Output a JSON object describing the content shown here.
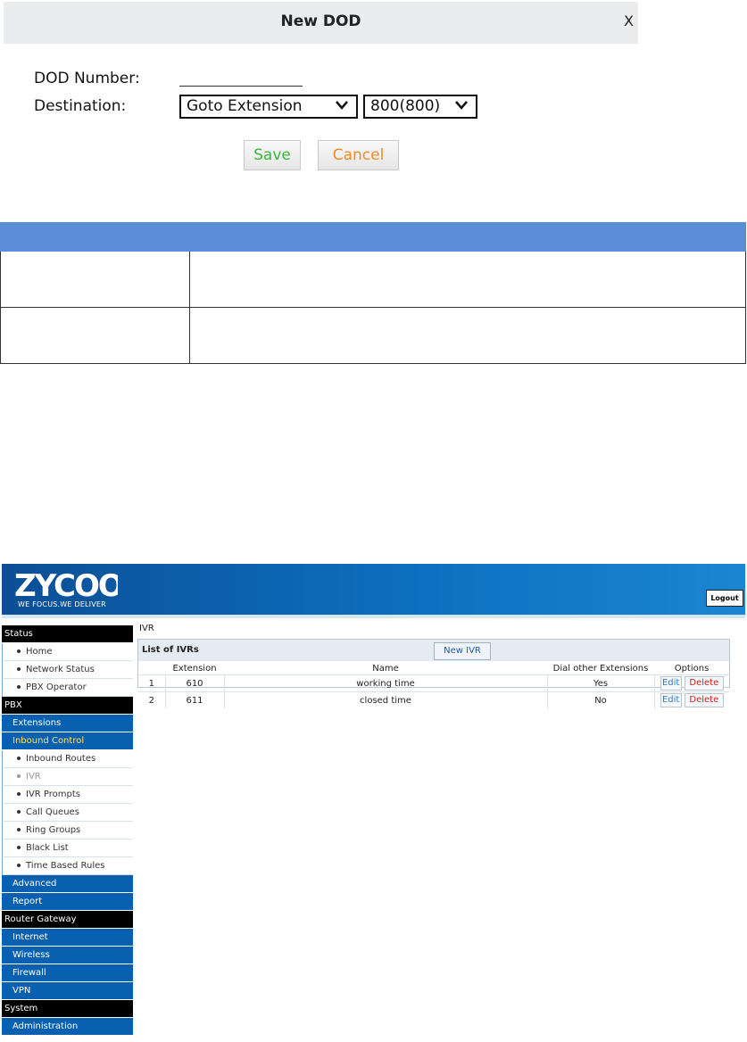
{
  "dialog": {
    "title": "New DOD",
    "close": "X",
    "dod_number_label": "DOD Number:",
    "destination_label": "Destination:",
    "destination_type": "Goto Extension",
    "destination_value": "800(800)",
    "save_label": "Save",
    "cancel_label": "Cancel"
  },
  "zycoo": {
    "brand": "ZYCOO",
    "slogan": "WE FOCUS.WE DELIVER",
    "logout_label": "Logout",
    "breadcrumb": "IVR",
    "nav": {
      "status_header": "Status",
      "status_items": [
        "Home",
        "Network Status",
        "PBX Operator"
      ],
      "pbx_header": "PBX",
      "extensions": "Extensions",
      "inbound_control": "Inbound Control",
      "inbound_items": [
        "Inbound Routes",
        "IVR",
        "IVR Prompts",
        "Call Queues",
        "Ring Groups",
        "Black List",
        "Time Based Rules"
      ],
      "advanced": "Advanced",
      "report": "Report",
      "router_header": "Router Gateway",
      "router_items": [
        "Internet",
        "Wireless",
        "Firewall",
        "VPN"
      ],
      "system_header": "System",
      "system_items": [
        "Administration"
      ]
    },
    "ivr_list": {
      "title": "List of IVRs",
      "new_button": "New IVR",
      "headers": [
        "Extension",
        "Name",
        "Dial other Extensions",
        "Options"
      ],
      "rows": [
        {
          "num": "1",
          "extension": "610",
          "name": "working time",
          "dial_other": "Yes"
        },
        {
          "num": "2",
          "extension": "611",
          "name": "closed time",
          "dial_other": "No"
        }
      ],
      "edit_label": "Edit",
      "delete_label": "Delete"
    }
  },
  "colors": {
    "table_header_blue": "#5b8ed9",
    "nav_blue": "#0a60b0",
    "save_green": "#3cb83c",
    "cancel_orange": "#f08c28"
  }
}
